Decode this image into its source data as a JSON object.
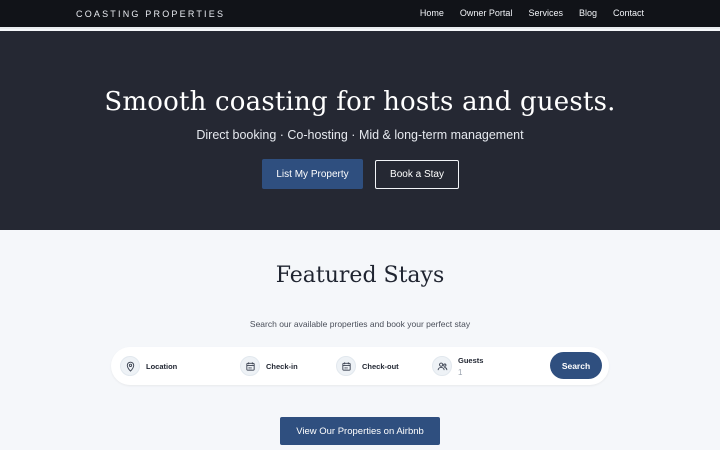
{
  "nav": {
    "brand": "COASTING PROPERTIES",
    "links": [
      "Home",
      "Owner Portal",
      "Services",
      "Blog",
      "Contact"
    ]
  },
  "hero": {
    "title": "Smooth coasting for hosts and guests.",
    "subtitle": "Direct booking · Co-hosting · Mid & long-term management",
    "primary_cta": "List My Property",
    "secondary_cta": "Book a Stay"
  },
  "featured": {
    "title": "Featured Stays",
    "subtitle": "Search our available properties and book your perfect stay"
  },
  "search": {
    "location_label": "Location",
    "checkin_label": "Check-in",
    "checkout_label": "Check-out",
    "guests_label": "Guests",
    "guests_value": "1",
    "button_label": "Search",
    "icons": {
      "location": "map-pin-icon",
      "checkin": "calendar-icon",
      "checkout": "calendar-icon",
      "guests": "users-icon"
    }
  },
  "airbnb_button": "View Our Properties on Airbnb",
  "colors": {
    "nav_bg": "#111318",
    "hero_bg": "#252833",
    "accent": "#2f4f7f",
    "page_bg": "#f5f7fa"
  }
}
